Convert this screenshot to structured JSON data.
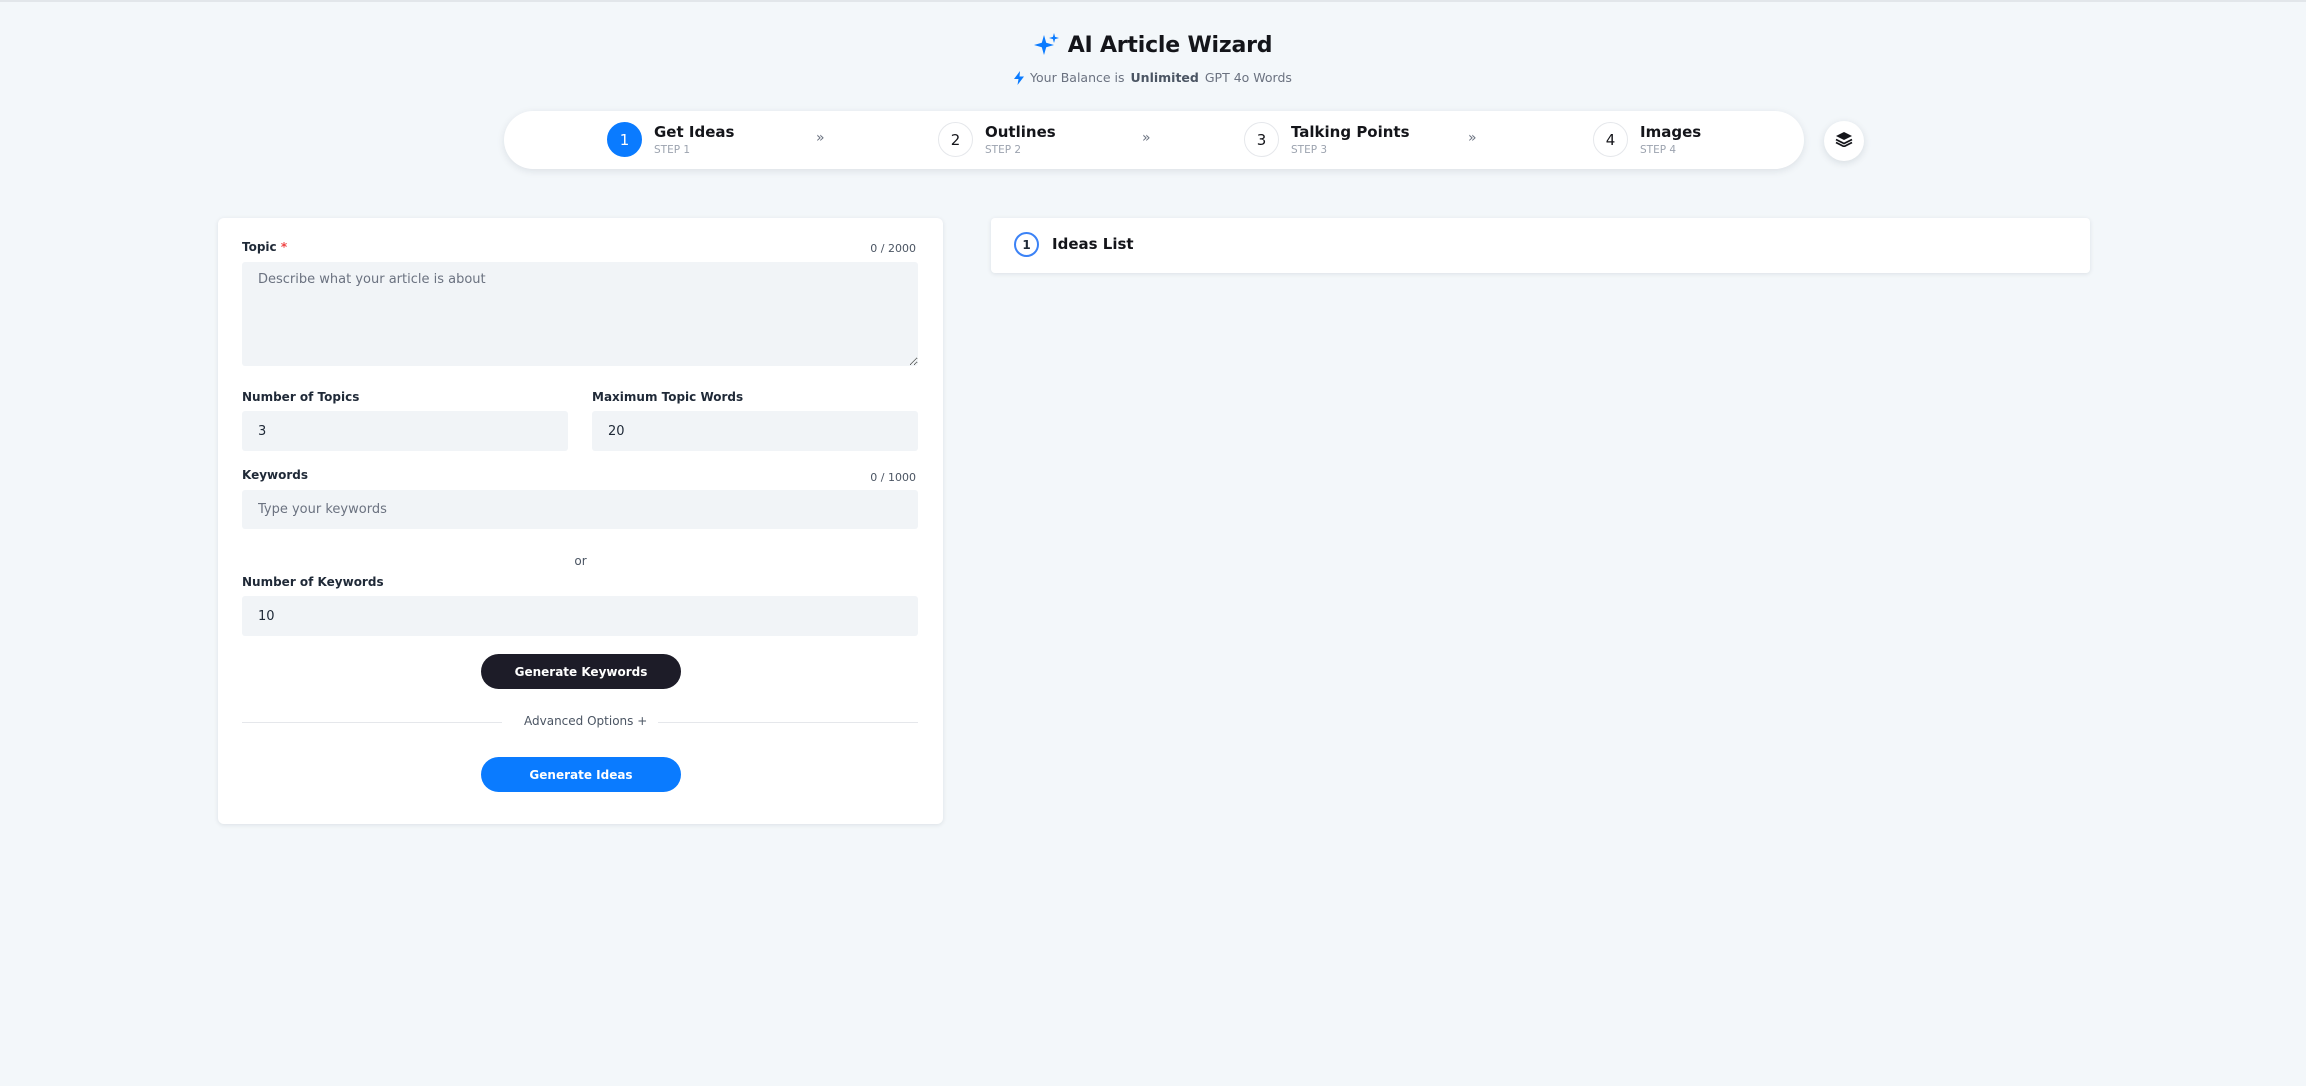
{
  "header": {
    "title": "AI Article Wizard",
    "balance_prefix": "Your Balance is",
    "balance_value": "Unlimited",
    "balance_suffix": "GPT 4o Words",
    "icon": "sparkles-icon"
  },
  "stepper": {
    "steps": [
      {
        "num": "1",
        "title": "Get Ideas",
        "sub": "STEP 1",
        "active": true
      },
      {
        "num": "2",
        "title": "Outlines",
        "sub": "STEP 2",
        "active": false
      },
      {
        "num": "3",
        "title": "Talking Points",
        "sub": "STEP 3",
        "active": false
      },
      {
        "num": "4",
        "title": "Images",
        "sub": "STEP 4",
        "active": false
      }
    ],
    "arrow": "»",
    "accent": "#0a7bff"
  },
  "form": {
    "topic_label": "Topic",
    "required_mark": "*",
    "topic_counter": "0 / 2000",
    "topic_placeholder": "Describe what your article is about",
    "num_topics_label": "Number of Topics",
    "num_topics_value": "3",
    "max_words_label": "Maximum Topic Words",
    "max_words_value": "20",
    "keywords_label": "Keywords",
    "keywords_counter": "0 / 1000",
    "keywords_placeholder": "Type your keywords",
    "or_text": "or",
    "num_keywords_label": "Number of Keywords",
    "num_keywords_value": "10",
    "generate_keywords_label": "Generate Keywords",
    "advanced_options_label": "Advanced Options +",
    "generate_ideas_label": "Generate Ideas"
  },
  "ideas": {
    "num": "1",
    "title": "Ideas List"
  }
}
